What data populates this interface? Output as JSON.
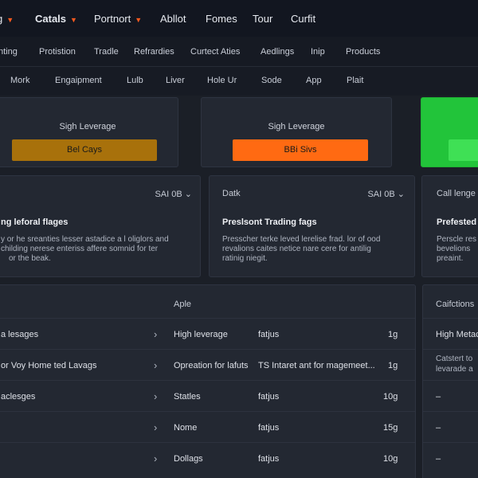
{
  "nav_primary": [
    {
      "label": "g",
      "caret": true
    },
    {
      "label": "Catals",
      "caret": true
    },
    {
      "label": "Portnort",
      "caret": true
    },
    {
      "label": "Abllot"
    },
    {
      "label": "Fomes"
    },
    {
      "label": "Tour"
    },
    {
      "label": "Curfit"
    }
  ],
  "nav_secondary": [
    "nting",
    "Protistion",
    "Tradle",
    "Refrardies",
    "Curtect Aties",
    "Aedlings",
    "Inip",
    "Products"
  ],
  "nav_tertiary": [
    "Mork",
    "Engaipment",
    "Lulb",
    "Liver",
    "Hole Ur",
    "Sode",
    "App",
    "Plait"
  ],
  "leverage_cards": [
    {
      "title": "Sigh Leverage",
      "button": "Bel Cays",
      "color": "#a8710b"
    },
    {
      "title": "Sigh Leverage",
      "button": "BBi Sivs",
      "color": "#ff6a12"
    },
    {
      "title": "",
      "button": "",
      "color": "#22c43a"
    }
  ],
  "info_cards": [
    {
      "head": "",
      "select": "SAI 0B",
      "title": "ng leforal flages",
      "desc": [
        "y or he sreanties lesser astadice a l oliglors and",
        "childing nerese enteriss affere somnid for ter",
        "or the beak."
      ]
    },
    {
      "head": "Datk",
      "select": "SAI 0B",
      "title": "Preslsont Trading fags",
      "desc": [
        "Presscher terke leved lerelise frad. lor of ood",
        "revalions caites netice nare cere for antilig",
        "ratinig niegit."
      ]
    },
    {
      "head": "Call lenge",
      "select": "",
      "title": "Prefested t",
      "desc": [
        "Perscle res",
        "bevelions",
        "preaint."
      ]
    }
  ],
  "table": {
    "header": "Aple",
    "rows": [
      {
        "name": "a lesages",
        "type": "High leverage",
        "status": "fatjus",
        "value": "1g"
      },
      {
        "name": "or Voy Home ted Lavags",
        "type": "Opreation for lafuts",
        "status": "TS Intaret ant for magemeet...",
        "value": "1g"
      },
      {
        "name": "aclesges",
        "type": "Statles",
        "status": "fatjus",
        "value": "10g"
      },
      {
        "name": "",
        "type": "Nome",
        "status": "fatjus",
        "value": "15g"
      },
      {
        "name": "",
        "type": "Dollags",
        "status": "fatjus",
        "value": "10g"
      }
    ]
  },
  "side_panel": {
    "header": "Caifctions",
    "rows": [
      "High Metac",
      "Catstert to",
      "–",
      "–",
      "–"
    ],
    "row2_sub": "levarade a"
  },
  "icons": {
    "caret": "caret-down-icon",
    "chevron": "chevron-right-icon",
    "select": "chevron-down-icon"
  }
}
